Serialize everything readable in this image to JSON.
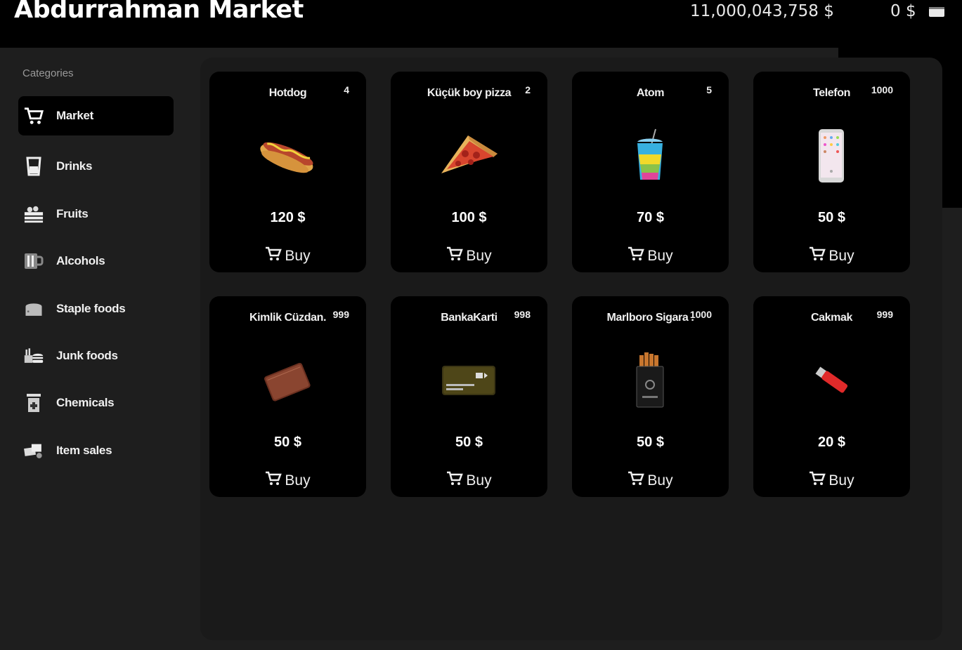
{
  "header": {
    "title": "Abdurrahman Market",
    "bank_balance": "11,000,043,758 $",
    "cash_balance": "0 $",
    "bank_icon": "credit-card-icon",
    "cash_icon": "wallet-icon"
  },
  "sidebar": {
    "heading": "Categories",
    "items": [
      {
        "label": "Market",
        "icon": "cart-icon",
        "active": true
      },
      {
        "label": "Drinks",
        "icon": "cup-icon"
      },
      {
        "label": "Fruits",
        "icon": "fruit-crate-icon"
      },
      {
        "label": "Alcohols",
        "icon": "beer-icon"
      },
      {
        "label": "Staple foods",
        "icon": "bread-icon"
      },
      {
        "label": "Junk foods",
        "icon": "burger-icon"
      },
      {
        "label": "Chemicals",
        "icon": "chemical-bottle-icon"
      },
      {
        "label": "Item sales",
        "icon": "item-sales-icon"
      }
    ]
  },
  "products": [
    {
      "name": "Hotdog",
      "stock": "4",
      "price": "120 $",
      "icon": "hotdog-icon"
    },
    {
      "name": "Küçük boy pizza",
      "stock": "2",
      "price": "100 $",
      "icon": "pizza-icon"
    },
    {
      "name": "Atom",
      "stock": "5",
      "price": "70 $",
      "icon": "slush-drink-icon"
    },
    {
      "name": "Telefon",
      "stock": "1000",
      "price": "50 $",
      "icon": "phone-icon"
    },
    {
      "name": "Kimlik Cüzdan.",
      "stock": "999",
      "price": "50 $",
      "icon": "wallet-item-icon"
    },
    {
      "name": "BankaKarti",
      "stock": "998",
      "price": "50 $",
      "icon": "bank-card-icon"
    },
    {
      "name": "Marlboro Sigara .",
      "stock": "1000",
      "price": "50 $",
      "icon": "cigarette-pack-icon"
    },
    {
      "name": "Cakmak",
      "stock": "999",
      "price": "20 $",
      "icon": "lighter-icon"
    }
  ],
  "buy_label": "Buy",
  "colors": {
    "background": "#1e1e1e",
    "card": "#000000",
    "topbar": "#000000"
  }
}
